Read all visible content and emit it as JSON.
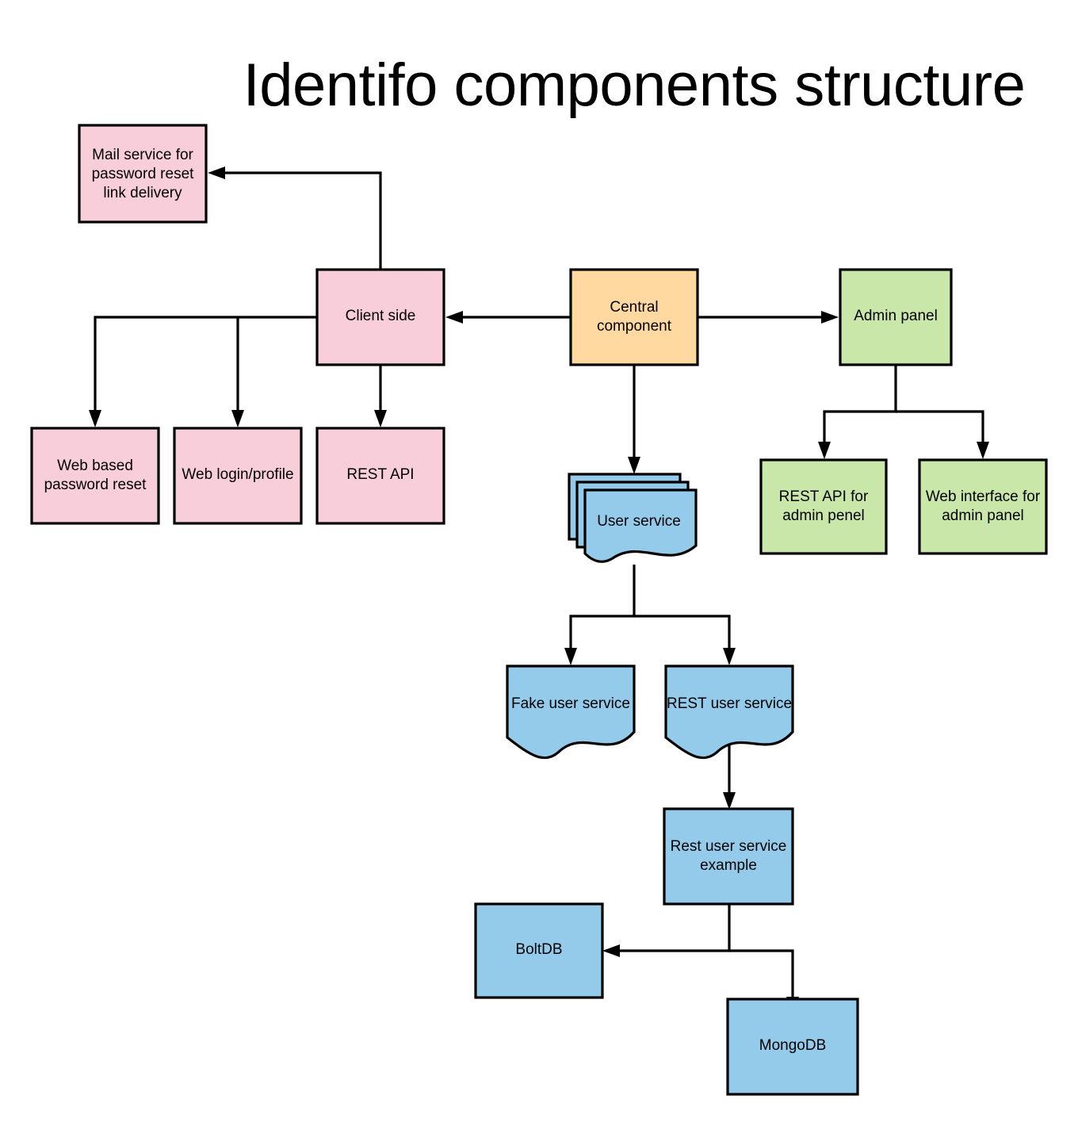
{
  "title": "Identifo components structure",
  "palette": {
    "pink": "#f8cedb",
    "orange": "#ffd9a0",
    "green": "#c9e7a9",
    "blue": "#94cbeb",
    "stroke": "#000000",
    "background": "#ffffff"
  },
  "nodes": {
    "mail_service": {
      "label_line1": "Mail service for",
      "label_line2": "password reset",
      "label_line3": "link delivery",
      "color": "#f8cedb",
      "shape": "rectangle"
    },
    "client_side": {
      "label_line1": "Client side",
      "color": "#f8cedb",
      "shape": "rectangle"
    },
    "central_component": {
      "label_line1": "Central",
      "label_line2": "component",
      "color": "#ffd9a0",
      "shape": "rectangle"
    },
    "admin_panel": {
      "label_line1": "Admin panel",
      "color": "#c9e7a9",
      "shape": "rectangle"
    },
    "web_based_password_reset": {
      "label_line1": "Web based",
      "label_line2": "password reset",
      "color": "#f8cedb",
      "shape": "rectangle"
    },
    "web_login_profile": {
      "label_line1": "Web login/profile",
      "color": "#f8cedb",
      "shape": "rectangle"
    },
    "rest_api": {
      "label_line1": "REST API",
      "color": "#f8cedb",
      "shape": "rectangle"
    },
    "rest_api_for_admin_panel": {
      "label_line1": "REST API for",
      "label_line2": "admin penel",
      "color": "#c9e7a9",
      "shape": "rectangle"
    },
    "web_interface_for_admin_panel": {
      "label_line1": "Web interface for",
      "label_line2": "admin panel",
      "color": "#c9e7a9",
      "shape": "rectangle"
    },
    "user_service": {
      "label_line1": "User service",
      "color": "#94cbeb",
      "shape": "multi-document"
    },
    "fake_user_service": {
      "label_line1": "Fake user service",
      "color": "#94cbeb",
      "shape": "document"
    },
    "rest_user_service": {
      "label_line1": "REST user service",
      "color": "#94cbeb",
      "shape": "document"
    },
    "rest_user_service_example": {
      "label_line1": "Rest user service",
      "label_line2": "example",
      "color": "#94cbeb",
      "shape": "rectangle"
    },
    "boltdb": {
      "label_line1": "BoltDB",
      "color": "#94cbeb",
      "shape": "rectangle"
    },
    "mongodb": {
      "label_line1": "MongoDB",
      "color": "#94cbeb",
      "shape": "rectangle"
    }
  },
  "edges": [
    {
      "from": "client_side",
      "to": "mail_service"
    },
    {
      "from": "central_component",
      "to": "client_side"
    },
    {
      "from": "central_component",
      "to": "admin_panel"
    },
    {
      "from": "central_component",
      "to": "user_service"
    },
    {
      "from": "client_side",
      "to": "web_based_password_reset"
    },
    {
      "from": "client_side",
      "to": "web_login_profile"
    },
    {
      "from": "client_side",
      "to": "rest_api"
    },
    {
      "from": "admin_panel",
      "to": "rest_api_for_admin_panel"
    },
    {
      "from": "admin_panel",
      "to": "web_interface_for_admin_panel"
    },
    {
      "from": "user_service",
      "to": "fake_user_service"
    },
    {
      "from": "user_service",
      "to": "rest_user_service"
    },
    {
      "from": "rest_user_service",
      "to": "rest_user_service_example"
    },
    {
      "from": "rest_user_service_example",
      "to": "boltdb"
    },
    {
      "from": "rest_user_service_example",
      "to": "mongodb"
    }
  ]
}
